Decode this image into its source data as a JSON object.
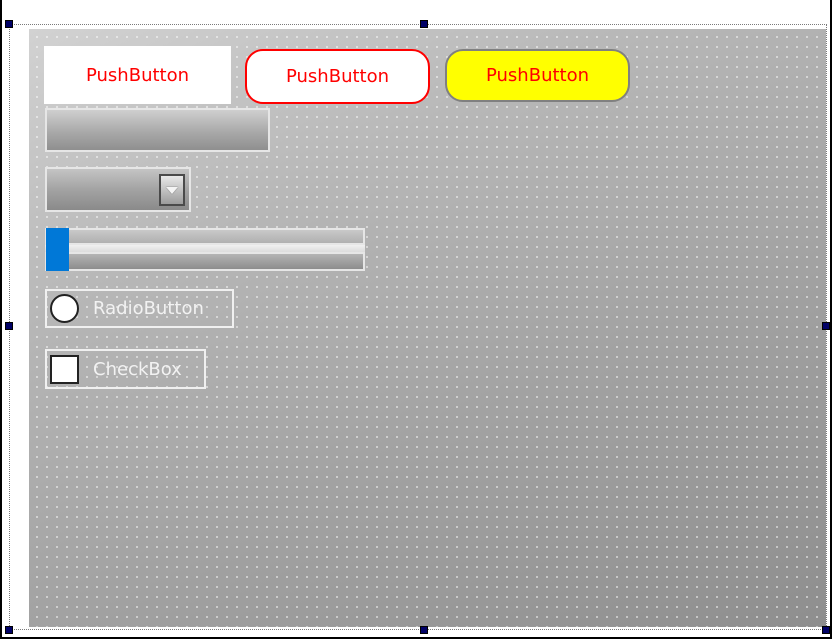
{
  "form": {
    "push_button_1": {
      "label": "PushButton",
      "text_color": "#ff0000",
      "background": "#ffffff"
    },
    "push_button_2": {
      "label": "PushButton",
      "text_color": "#ff0000",
      "background": "#ffffff",
      "border_color": "#ff0000"
    },
    "push_button_3": {
      "label": "PushButton",
      "text_color": "#ff0000",
      "background": "#ffff00",
      "border_color": "#808080"
    },
    "progress_bar": {
      "value": 0
    },
    "combo_box": {
      "selected": ""
    },
    "slider": {
      "value": 0,
      "handle_color": "#0078d7"
    },
    "radio_button": {
      "label": "RadioButton",
      "checked": false
    },
    "check_box": {
      "label": "CheckBox",
      "checked": false
    }
  },
  "selection_handle_color": "#000066"
}
